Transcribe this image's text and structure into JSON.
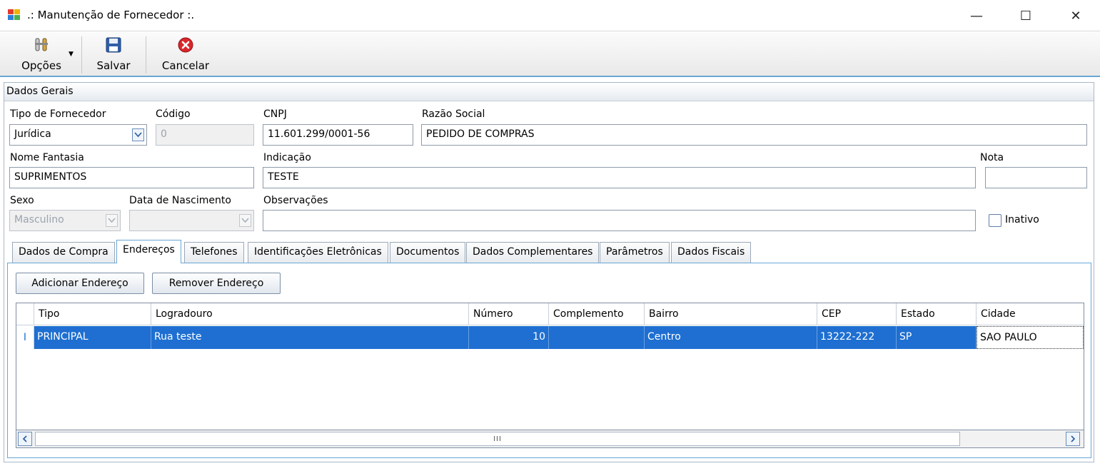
{
  "window": {
    "title": ".: Manutenção de Fornecedor :.",
    "minimize_glyph": "—",
    "maximize_glyph": "☐",
    "close_glyph": "✕"
  },
  "toolbar": {
    "options_label": "Opções",
    "save_label": "Salvar",
    "cancel_label": "Cancelar"
  },
  "group": {
    "title": "Dados Gerais"
  },
  "form": {
    "tipo_label": "Tipo de Fornecedor",
    "tipo_value": "Jurídica",
    "codigo_label": "Código",
    "codigo_value": "0",
    "cnpj_label": "CNPJ",
    "cnpj_value": "11.601.299/0001-56",
    "razao_label": "Razão Social",
    "razao_value": "PEDIDO DE COMPRAS",
    "fantasia_label": "Nome Fantasia",
    "fantasia_value": "SUPRIMENTOS",
    "indicacao_label": "Indicação",
    "indicacao_value": "TESTE",
    "nota_label": "Nota",
    "nota_value": "",
    "sexo_label": "Sexo",
    "sexo_value": "Masculino",
    "nascimento_label": "Data de Nascimento",
    "nascimento_value": "",
    "obs_label": "Observações",
    "obs_value": "",
    "inativo_label": "Inativo"
  },
  "tabs": [
    {
      "label": "Dados de Compra"
    },
    {
      "label": "Endereços"
    },
    {
      "label": "Telefones"
    },
    {
      "label": "Identificações Eletrônicas"
    },
    {
      "label": "Documentos"
    },
    {
      "label": "Dados Complementares"
    },
    {
      "label": "Parâmetros"
    },
    {
      "label": "Dados Fiscais"
    }
  ],
  "address": {
    "add_label": "Adicionar Endereço",
    "remove_label": "Remover Endereço",
    "columns": [
      "Tipo",
      "Logradouro",
      "Número",
      "Complemento",
      "Bairro",
      "CEP",
      "Estado",
      "Cidade"
    ],
    "rows": [
      {
        "indicator": "I",
        "cells": [
          "PRINCIPAL",
          "Rua teste",
          "10",
          "",
          "Centro",
          "13222-222",
          "SP",
          "SAO PAULO"
        ]
      }
    ],
    "scroll_grip": "III"
  },
  "colors": {
    "selection": "#1e6fd1",
    "accent": "#6aa7d6"
  }
}
